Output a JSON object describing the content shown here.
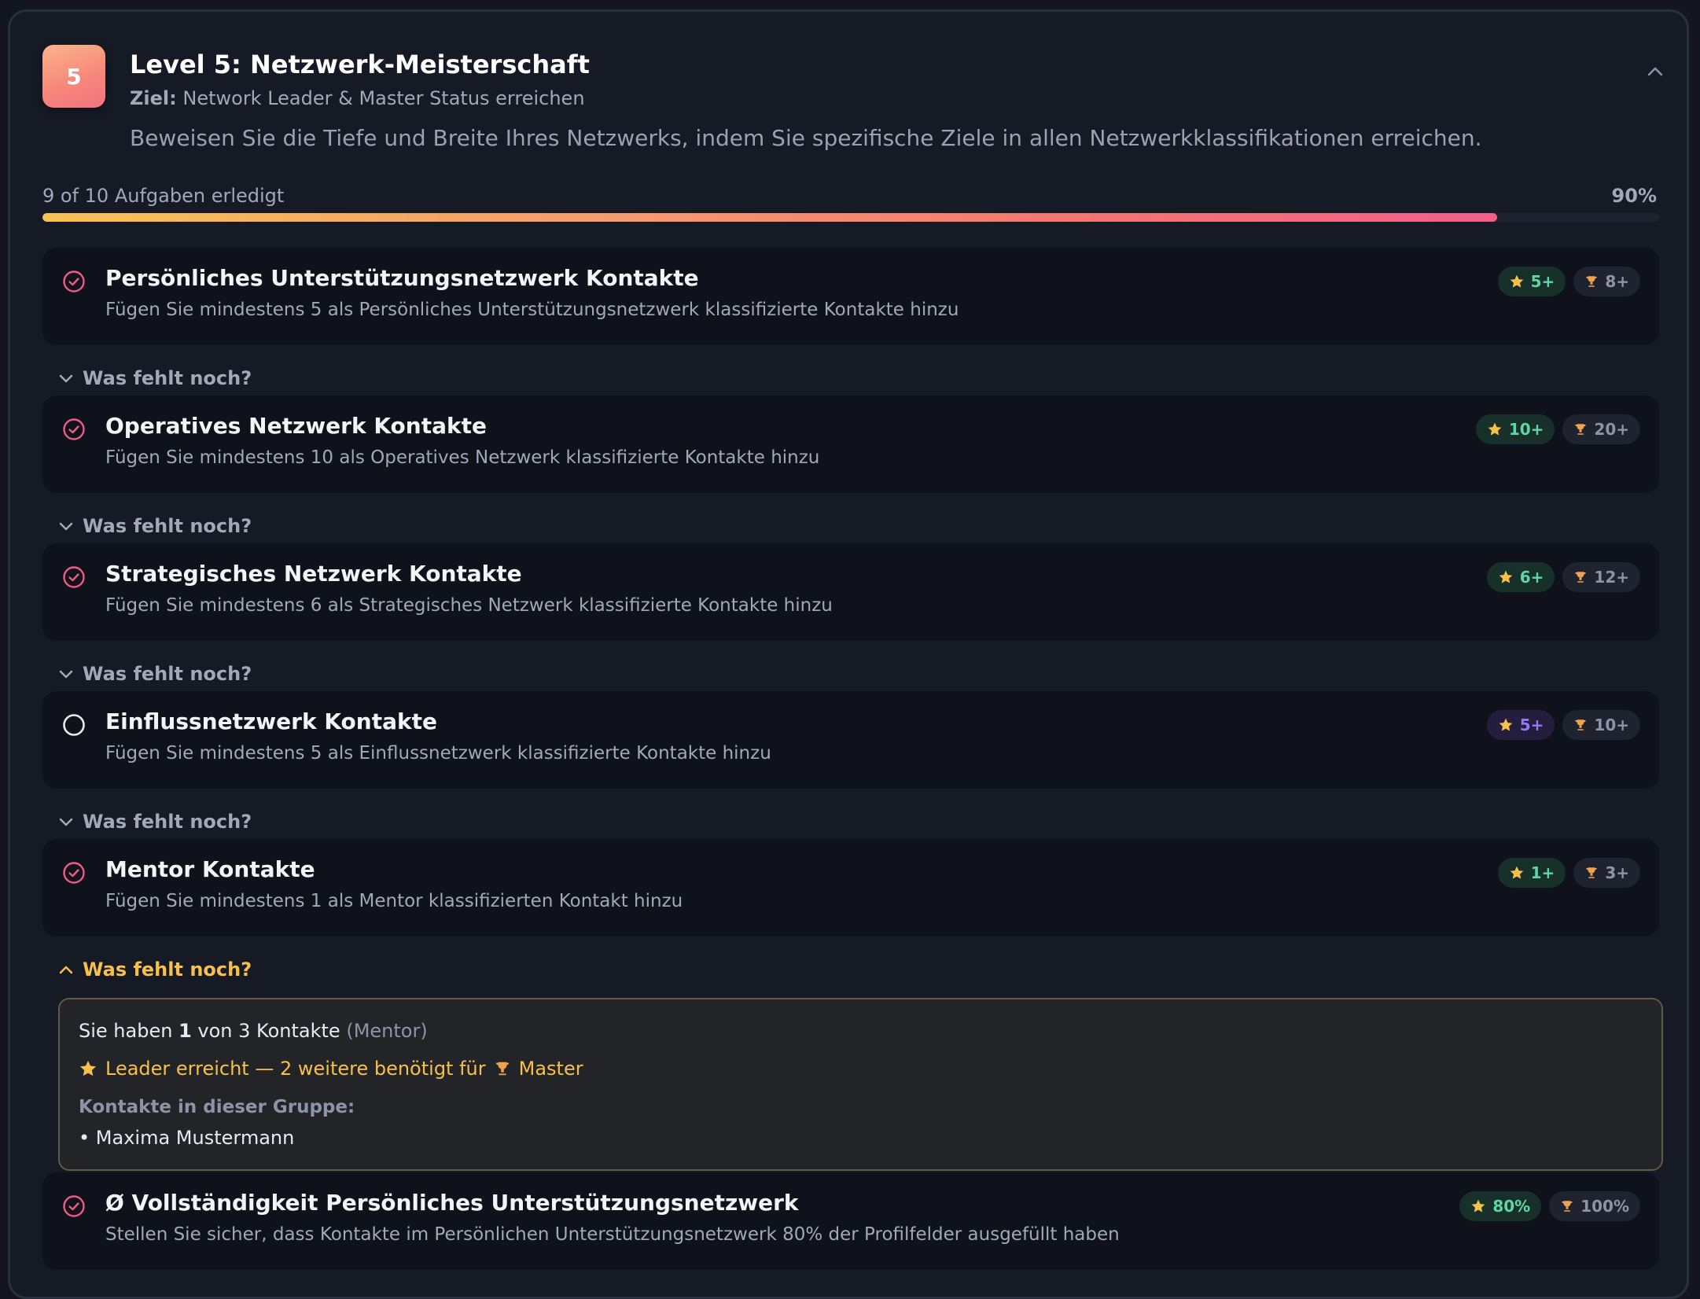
{
  "level": {
    "number": "5",
    "title": "Level 5: Netzwerk-Meisterschaft",
    "goal_label": "Ziel:",
    "goal_text": "Network Leader & Master Status erreichen",
    "description": "Beweisen Sie die Tiefe und Breite Ihres Netzwerks, indem Sie spezifische Ziele in allen Netzwerkklassifikationen erreichen."
  },
  "progress": {
    "label": "9 of 10 Aufgaben erledigt",
    "percent_label": "90%",
    "fraction": 0.9
  },
  "missing_label": "Was fehlt noch?",
  "tasks": [
    {
      "title": "Persönliches Unterstützungsnetzwerk Kontakte",
      "description": "Fügen Sie mindestens 5 als Persönliches Unterstützungsnetzwerk klassifizierte Kontakte hinzu",
      "leader": "5+",
      "master": "8+",
      "done": true
    },
    {
      "title": "Operatives Netzwerk Kontakte",
      "description": "Fügen Sie mindestens 10 als Operatives Netzwerk klassifizierte Kontakte hinzu",
      "leader": "10+",
      "master": "20+",
      "done": true
    },
    {
      "title": "Strategisches Netzwerk Kontakte",
      "description": "Fügen Sie mindestens 6 als Strategisches Netzwerk klassifizierte Kontakte hinzu",
      "leader": "6+",
      "master": "12+",
      "done": true
    },
    {
      "title": "Einflussnetzwerk Kontakte",
      "description": "Fügen Sie mindestens 5 als Einflussnetzwerk klassifizierte Kontakte hinzu",
      "leader": "5+",
      "master": "10+",
      "done": false
    },
    {
      "title": "Mentor Kontakte",
      "description": "Fügen Sie mindestens 1 als Mentor klassifizierten Kontakt hinzu",
      "leader": "1+",
      "master": "3+",
      "done": true
    },
    {
      "title": "Ø Vollständigkeit Persönliches Unterstützungsnetzwerk",
      "description": "Stellen Sie sicher, dass Kontakte im Persönlichen Unterstützungsnetzwerk 80% der Profilfelder ausgefüllt haben",
      "leader": "80%",
      "master": "100%",
      "done": true
    }
  ],
  "details": {
    "have_prefix": "Sie haben",
    "have_count": "1",
    "have_suffix": "von 3 Kontakte",
    "group": "(Mentor)",
    "status_leader": "Leader erreicht — 2 weitere benötigt für",
    "status_master": "Master",
    "contacts_heading": "Kontakte in dieser Gruppe:",
    "contact_1": "• Maxima Mustermann"
  },
  "colors": {
    "accent_pink": "#f05a86",
    "accent_yellow": "#f7c04a",
    "leader_green": "#5fd6a3"
  }
}
